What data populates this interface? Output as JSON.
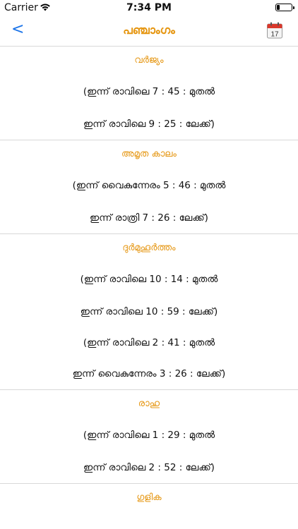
{
  "status": {
    "carrier": "Carrier",
    "time": "7:34 PM",
    "battery_level": 0.2
  },
  "nav": {
    "back_glyph": "<",
    "title": "പഞ്ചാംഗം",
    "calendar_day": "17",
    "calendar_icon": "calendar-icon"
  },
  "sections": [
    {
      "title": "വർജ്യം",
      "rows": [
        "(ഇന്ന് രാവിലെ 7 : 45 : മുതൽ",
        "ഇന്ന് രാവിലെ 9 : 25 : ലേക്ക്)"
      ]
    },
    {
      "title": "അമൃത കാലം",
      "rows": [
        "(ഇന്ന് വൈകുന്നേരം 5 : 46 : മുതൽ",
        "ഇന്ന് രാത്രി 7 : 26 : ലേക്ക്)"
      ]
    },
    {
      "title": "ദുർമുഹൂർത്തം",
      "rows": [
        "(ഇന്ന് രാവിലെ 10 : 14 : മുതൽ",
        "ഇന്ന് രാവിലെ 10 : 59 : ലേക്ക്)",
        "(ഇന്ന് രാവിലെ 2 : 41 : മുതൽ",
        "ഇന്ന് വൈകുന്നേരം 3 : 26 : ലേക്ക്)"
      ]
    },
    {
      "title": "രാഹു",
      "rows": [
        "(ഇന്ന് രാവിലെ 1 : 29 : മുതൽ",
        "ഇന്ന് രാവിലെ 2 : 52 : ലേക്ക്)"
      ]
    },
    {
      "title": "ഗുളിക",
      "rows": []
    }
  ]
}
